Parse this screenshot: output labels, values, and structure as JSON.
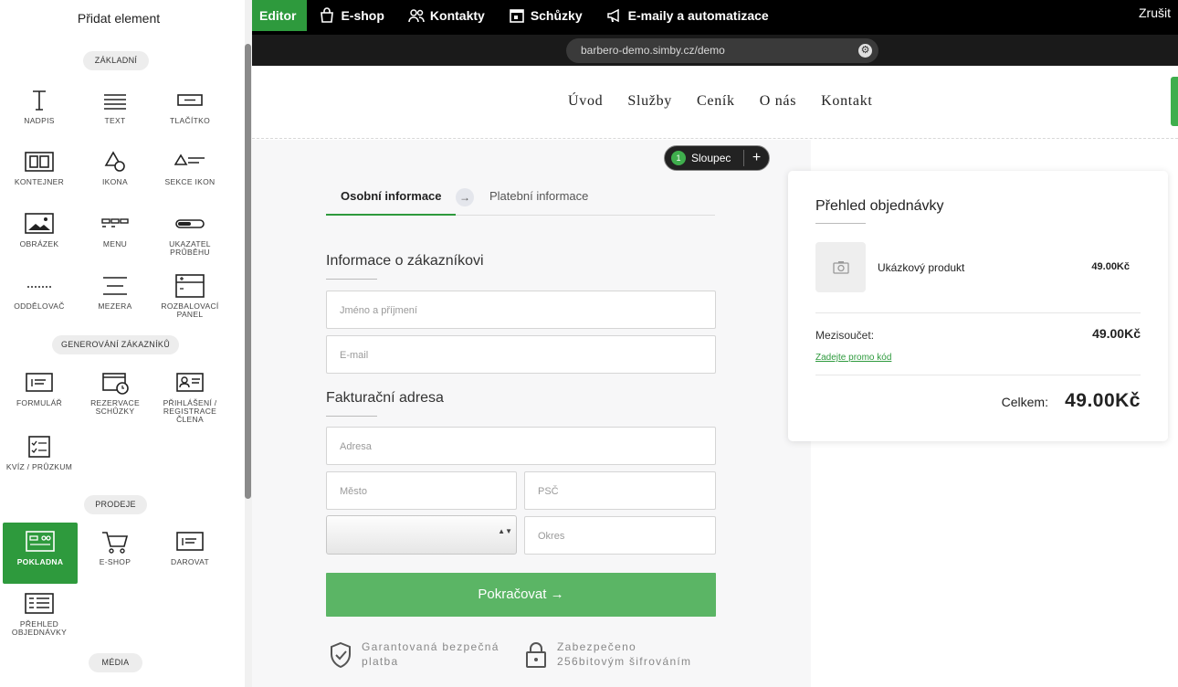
{
  "topbar": {
    "tabs": [
      {
        "label": "Editor",
        "icon": "editor",
        "active": true
      },
      {
        "label": "E-shop",
        "icon": "shopping-bag-icon"
      },
      {
        "label": "Kontakty",
        "icon": "contacts-icon"
      },
      {
        "label": "Schůzky",
        "icon": "calendar-icon"
      },
      {
        "label": "E-maily a automatizace",
        "icon": "megaphone-icon"
      }
    ],
    "cancel_label": "Zrušit",
    "accent": "#2e9a3d"
  },
  "urlbar": {
    "url": "barbero-demo.simby.cz/demo",
    "settings_icon": "gear-icon"
  },
  "panel": {
    "title": "Přidat element",
    "categories": {
      "basic": "ZÁKLADNÍ",
      "leadgen": "GENEROVÁNÍ ZÁKAZNÍKŮ",
      "sales": "PRODEJE",
      "media": "MÉDIA"
    },
    "items": {
      "heading": "NADPIS",
      "text": "TEXT",
      "button": "TLAČÍTKO",
      "container": "KONTEJNER",
      "icon": "IKONA",
      "icon_section": "SEKCE IKON",
      "image": "OBRÁZEK",
      "menu": "MENU",
      "progress": "UKAZATEL PRŮBĚHU",
      "divider": "ODDĚLOVAČ",
      "spacer": "MEZERA",
      "accordion": "ROZBALOVACÍ PANEL",
      "form": "FORMULÁŘ",
      "booking": "REZERVACE SCHŮZKY",
      "login": "PŘIHLÁŠENÍ / REGISTRACE ČLENA",
      "quiz": "KVÍZ / PRŮZKUM",
      "checkout": "POKLADNA",
      "eshop": "E-SHOP",
      "donate": "DAROVAT",
      "order_summary": "PŘEHLED OBJEDNÁVKY"
    },
    "selected": "POKLADNA"
  },
  "site": {
    "nav": [
      "Úvod",
      "Služby",
      "Ceník",
      "O nás",
      "Kontakt"
    ],
    "column_pill": {
      "number": "1",
      "label": "Sloupec",
      "add": "+"
    },
    "steps": {
      "step1": "Osobní informace",
      "arrow": "→",
      "step2": "Platební informace"
    },
    "customer": {
      "heading": "Informace o zákazníkovi",
      "name_placeholder": "Jméno a příjmení",
      "email_placeholder": "E-mail"
    },
    "billing": {
      "heading": "Fakturační adresa",
      "address_placeholder": "Adresa",
      "city_placeholder": "Město",
      "zip_placeholder": "PSČ",
      "district_placeholder": "Okres",
      "select_arrows": "▲▼"
    },
    "cta_label": "Pokračovat →",
    "trust": {
      "secure_line1": "Garantovaná bezpečná",
      "secure_line2": "platba",
      "encrypted_line1": "Zabezpečeno",
      "encrypted_line2": "256bitovým šifrováním"
    },
    "summary": {
      "title": "Přehled objednávky",
      "product_name": "Ukázkový produkt",
      "product_price": "49.00Kč",
      "subtotal_label": "Mezisoučet:",
      "subtotal_value": "49.00Kč",
      "promo_label": "Zadejte promo kód",
      "total_label": "Celkem:",
      "total_value": "49.00Kč"
    }
  }
}
